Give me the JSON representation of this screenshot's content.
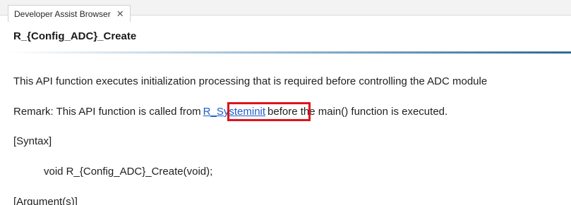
{
  "tab": {
    "label": "Developer Assist Browser",
    "close_glyph": "✕"
  },
  "page": {
    "title": "R_{Config_ADC}_Create",
    "description": "This API function executes initialization processing that is required before controlling the ADC module",
    "remark_prefix": "Remark: This API function is called from",
    "remark_link": "R_Systeminit",
    "remark_suffix": "before the main() function is executed.",
    "syntax_heading": "[Syntax]",
    "syntax_code": "void R_{Config_ADC}_Create(void);",
    "arguments_heading": "[Argument(s)]"
  },
  "icons": {
    "tab_close": "close-icon"
  },
  "colors": {
    "link": "#1d5cc7",
    "highlight": "#e0131b",
    "rule_end": "#2f6a96"
  }
}
